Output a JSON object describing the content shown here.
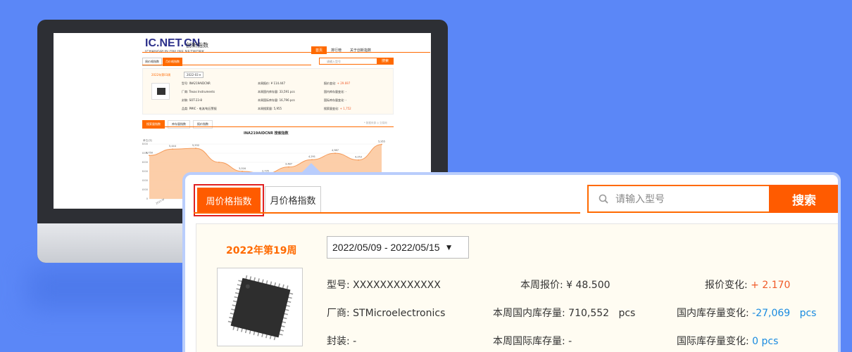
{
  "screen": {
    "logo_main": "IC.NET.CN",
    "logo_sub": "ICHANGRUN ONLINE NETWORK",
    "logo_cn": "交易网",
    "site_title": "创新指数",
    "nav": [
      "首页",
      "排行榜",
      "关于创新指数"
    ],
    "tabs": [
      "周价格指数",
      "月价格指数"
    ],
    "search_placeholder": "请输入型号",
    "search_button": "搜索",
    "week_label": "2022年第03周",
    "week_select": "2022-03 ▾",
    "fields": [
      {
        "label": "型号:",
        "value": "INA219AIDCNR"
      },
      {
        "label": "厂商:",
        "value": "Texas Instruments"
      },
      {
        "label": "封装:",
        "value": "SOT-23-8"
      },
      {
        "label": "品类:",
        "value": "PMIC - 电流/电压警报"
      }
    ],
    "mid_fields": [
      {
        "label": "本周报价:",
        "value": "¥ 114.447"
      },
      {
        "label": "本周国内库存量:",
        "value": "33,591  pcs"
      },
      {
        "label": "本周国际库存量:",
        "value": "16,796  pcs"
      },
      {
        "label": "本周搜索量:",
        "value": "5,955"
      }
    ],
    "right_fields": [
      {
        "label": "报价变化:",
        "value": "+ 29.697"
      },
      {
        "label": "国内库存量变化:",
        "value": "-"
      },
      {
        "label": "国际库存量变化:",
        "value": "-"
      },
      {
        "label": "搜索量变化:",
        "value": "+ 1,752"
      }
    ],
    "chart_tabs": [
      "搜索量指数",
      "库存量指数",
      "报价指数"
    ],
    "chart_note": "* 数据来源  ◎ 交易网",
    "chart_title": "INA219AIDCNR 搜索指数",
    "chart_ylabel": "单位(次)",
    "chart_yticks": [
      "6000",
      "5000",
      "4000",
      "3000",
      "2000",
      "1000",
      "0"
    ],
    "chart_xtick": "2021-W"
  },
  "popup": {
    "tabs": [
      "周价格指数",
      "月价格指数"
    ],
    "search_placeholder": "请输入型号",
    "search_button": "搜索",
    "week_label": "2022年第19周",
    "date_range": "2022/05/09 - 2022/05/15",
    "row1": {
      "label": "型号:",
      "value": "XXXXXXXXXXXXX",
      "mid_label": "本周报价:",
      "mid_value": "¥ 48.500",
      "right_label": "报价变化:",
      "right_value": "+ 2.170"
    },
    "row2": {
      "label": "厂商:",
      "value": "STMicroelectronics",
      "mid_label": "本周国内库存量:",
      "mid_value": "710,552",
      "mid_unit": "pcs",
      "right_label": "国内库存量变化:",
      "right_value": "-27,069",
      "right_unit": "pcs"
    },
    "row3": {
      "label": "封装:",
      "value": "-",
      "mid_label": "本周国际库存量:",
      "mid_value": "-",
      "right_label": "国际库存量变化:",
      "right_value": "0 pcs"
    }
  },
  "chart_data": {
    "type": "area",
    "title": "INA219AIDCNR 搜索指数",
    "ylabel": "单位(次)",
    "ylim": [
      0,
      6000
    ],
    "values": [
      4750,
      5444,
      5532,
      4000,
      3016,
      2735,
      3487,
      4291,
      4987,
      4253,
      5955
    ],
    "data_labels": [
      "4,750",
      "5,444",
      "5,532",
      "",
      "3,016",
      "2,735",
      "3,487",
      "4,291",
      "4,987",
      "4,253",
      "5,955"
    ]
  },
  "colors": {
    "accent": "#ff5b00",
    "background": "#5b87f7",
    "up": "#f05a28",
    "down": "#1a8be0"
  }
}
